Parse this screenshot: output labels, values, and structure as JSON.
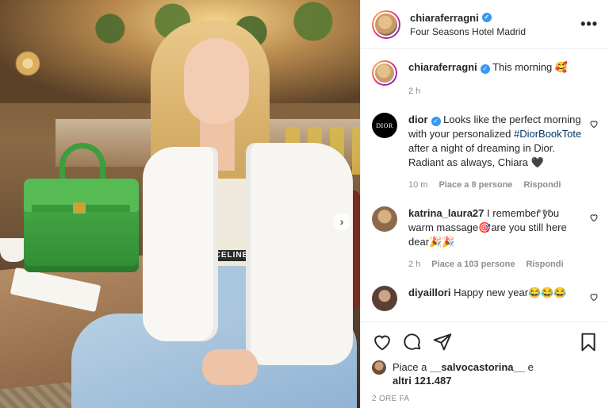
{
  "post": {
    "author": "chiaraferragni",
    "location": "Four Seasons Hotel Madrid",
    "photo_caption_text": "CELINE"
  },
  "caption": {
    "user": "chiaraferragni",
    "text": "This morning 🥰",
    "time": "2 h"
  },
  "comments": [
    {
      "user": "dior",
      "avatar_text": "DIOR",
      "text_before": " Looks like the perfect morning with your personalized ",
      "hashtag": "#DiorBookTote",
      "text_after": " after a night of dreaming in Dior. Radiant as always, Chiara 🖤",
      "time": "10 m",
      "likes": "Piace a 8 persone",
      "reply": "Rispondi"
    },
    {
      "user": "katrina_laura27",
      "text": " I remember you warm massage🎯are you still here dear🎉🎉",
      "time": "2 h",
      "likes": "Piace a 103 persone",
      "reply": "Rispondi"
    },
    {
      "user": "diyaillori",
      "text": " Happy new year😂😂😂"
    }
  ],
  "likes_summary": {
    "prefix": "Piace a ",
    "user": "__salvocastorina__",
    "mid": " e",
    "others": "altri 121.487"
  },
  "date": "2 ORE FA",
  "icons": {
    "verified": "verified-badge-icon",
    "more": "more-options-icon",
    "like": "heart-icon",
    "comment": "comment-bubble-icon",
    "share": "paper-plane-icon",
    "save": "bookmark-icon",
    "next": "chevron-right-icon"
  },
  "colors": {
    "verified": "#3897f0",
    "hashtag": "#00376b",
    "meta": "#8e8e8e"
  }
}
